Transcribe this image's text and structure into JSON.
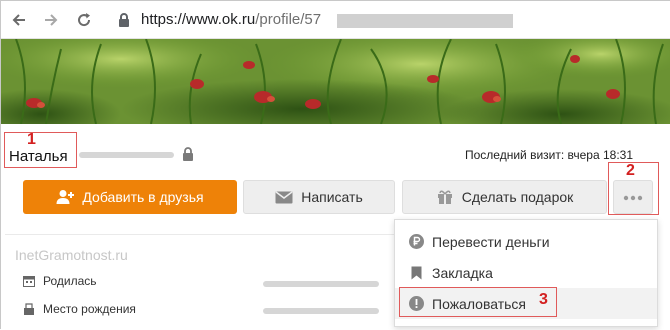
{
  "browser": {
    "url_domain": "https://www.ok.ru",
    "url_path": "/profile/57",
    "back_icon": "back-arrow-icon",
    "forward_icon": "forward-arrow-icon",
    "reload_icon": "reload-icon",
    "lock_icon": "lock-icon"
  },
  "profile": {
    "name": "Наталья",
    "last_visit": "Последний визит: вчера 18:31"
  },
  "actions": {
    "add_friend": "Добавить в друзья",
    "message": "Написать",
    "gift": "Сделать подарок"
  },
  "menu": {
    "items": [
      {
        "label": "Перевести деньги",
        "icon": "ruble-icon"
      },
      {
        "label": "Закладка",
        "icon": "bookmark-icon"
      },
      {
        "label": "Пожаловаться",
        "icon": "warning-icon"
      }
    ]
  },
  "info": {
    "born_label": "Родилась",
    "birthplace_label": "Место рождения"
  },
  "watermark": "InetGramotnost.ru",
  "markers": {
    "m1": "1",
    "m2": "2",
    "m3": "3"
  },
  "colors": {
    "primary": "#ee8208",
    "annotation": "#d32020"
  }
}
